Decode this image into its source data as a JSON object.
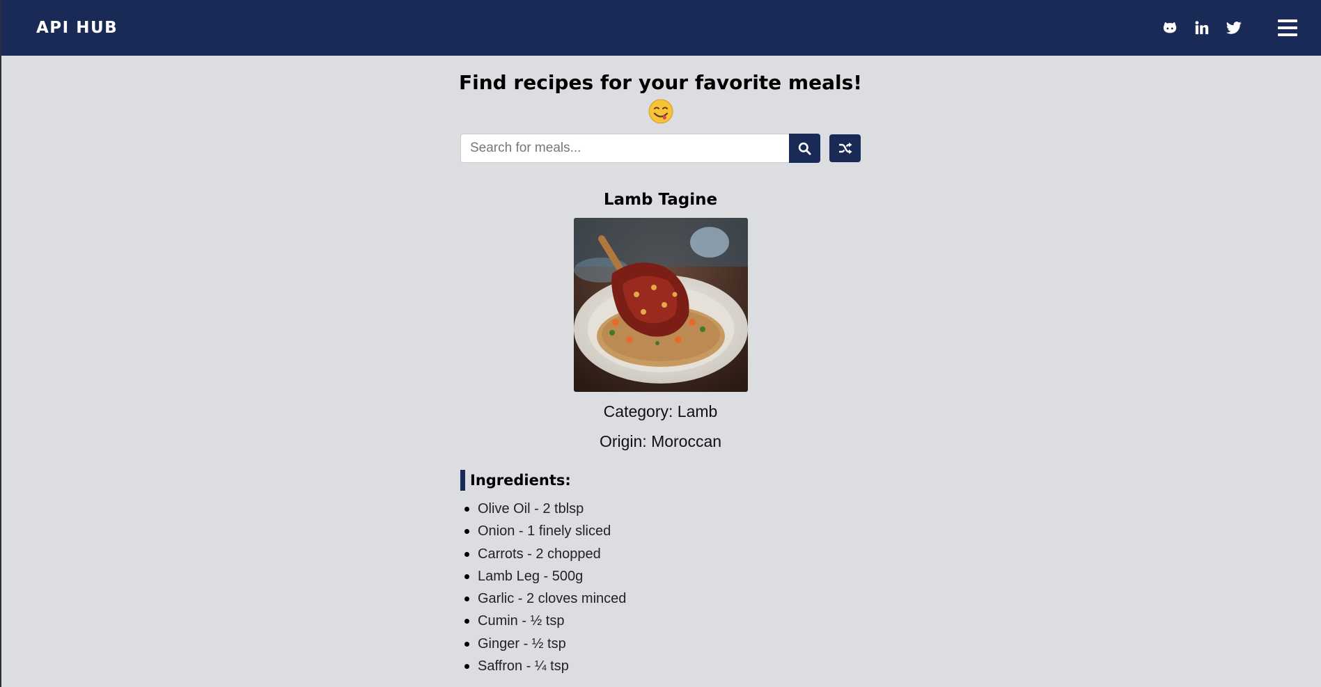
{
  "navbar": {
    "brand": "API HUB",
    "social_icons": [
      "github-icon",
      "linkedin-icon",
      "twitter-icon"
    ],
    "menu_icon": "hamburger-menu-icon"
  },
  "hero": {
    "headline": "Find recipes for your favorite meals!",
    "emoji": "face-savoring-food-emoji"
  },
  "search": {
    "placeholder": "Search for meals...",
    "value": "",
    "search_icon": "search-icon",
    "random_icon": "shuffle-icon"
  },
  "meal": {
    "title": "Lamb Tagine",
    "category": "Category: Lamb",
    "origin": "Origin: Moroccan",
    "ingredients_heading": "Ingredients:",
    "ingredients": [
      "Olive Oil - 2 tblsp",
      "Onion - 1 finely sliced",
      "Carrots - 2 chopped",
      "Lamb Leg - 500g",
      "Garlic - 2 cloves minced",
      "Cumin - ½ tsp",
      "Ginger - ½ tsp",
      "Saffron - ¼ tsp"
    ]
  },
  "colors": {
    "navbar": "#1a2a57",
    "background": "#dcdde1",
    "accent": "#1a2a57"
  }
}
